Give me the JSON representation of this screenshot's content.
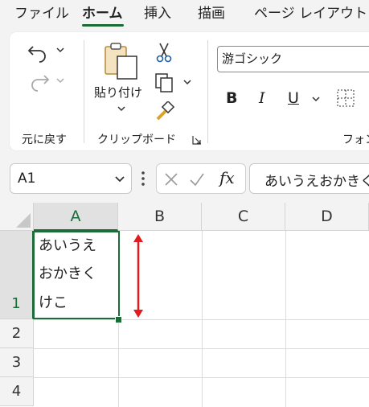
{
  "menu": {
    "tabs": [
      {
        "label": "ファイル"
      },
      {
        "label": "ホーム"
      },
      {
        "label": "挿入"
      },
      {
        "label": "描画"
      },
      {
        "label": "ページ レイアウト"
      }
    ]
  },
  "ribbon": {
    "undo_group_label": "元に戻す",
    "clipboard_group_label": "クリップボード",
    "paste_label": "貼り付け",
    "font_group_label": "フォン",
    "font_name": "游ゴシック",
    "bold_label": "B",
    "italic_label": "I",
    "underline_label": "U"
  },
  "formula_bar": {
    "name_box": "A1",
    "fx_label": "fx",
    "formula_content": "あいうえおかきくけこ"
  },
  "sheet": {
    "columns": [
      "A",
      "B",
      "C",
      "D"
    ],
    "rows": [
      "1",
      "2",
      "3",
      "4"
    ],
    "a1_lines": [
      "あいうえ",
      "おかきく",
      "けこ"
    ],
    "arrow_color": "#e11c1c",
    "accent_color": "#1e6b3a"
  }
}
